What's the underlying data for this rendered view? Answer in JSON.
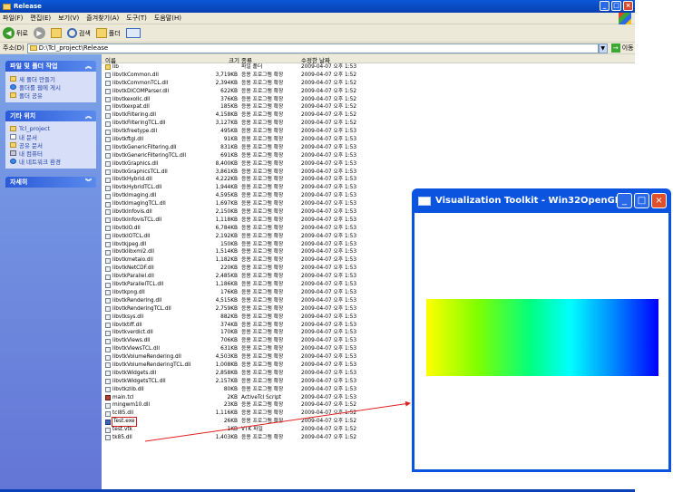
{
  "explorer": {
    "title": "Release",
    "menu": [
      "파일(F)",
      "편집(E)",
      "보기(V)",
      "즐겨찾기(A)",
      "도구(T)",
      "도움말(H)"
    ],
    "toolbar": {
      "back": "뒤로",
      "search": "검색",
      "folders": "폴더"
    },
    "address": {
      "label": "주소(D)",
      "path": "D:\\Tcl_project\\Release",
      "go": "이동"
    },
    "tasks": {
      "title": "파일 및 폴더 작업",
      "items": [
        "새 폴더 만들기",
        "폴더를 웹에 게시",
        "폴더 공유"
      ]
    },
    "places": {
      "title": "기타 위치",
      "items": [
        "Tcl_project",
        "내 문서",
        "공유 문서",
        "내 컴퓨터",
        "내 네트워크 환경"
      ]
    },
    "details": {
      "title": "자세히"
    },
    "columns": {
      "name": "이름",
      "size": "크기",
      "type": "종류",
      "date": "수정한 날짜"
    },
    "files": [
      {
        "name": "lib",
        "size": "",
        "type": "파일 폴더",
        "date": "2009-04-07 오후 1:53",
        "icon": "folder"
      },
      {
        "name": "libvtkCommon.dll",
        "size": "3,719KB",
        "type": "응용 프로그램 확장",
        "date": "2009-04-07 오후 1:52",
        "icon": "dll"
      },
      {
        "name": "libvtkCommonTCL.dll",
        "size": "2,394KB",
        "type": "응용 프로그램 확장",
        "date": "2009-04-07 오후 1:52",
        "icon": "dll"
      },
      {
        "name": "libvtkDICOMParser.dll",
        "size": "622KB",
        "type": "응용 프로그램 확장",
        "date": "2009-04-07 오후 1:52",
        "icon": "dll"
      },
      {
        "name": "libvtkexoIIc.dll",
        "size": "376KB",
        "type": "응용 프로그램 확장",
        "date": "2009-04-07 오후 1:52",
        "icon": "dll"
      },
      {
        "name": "libvtkexpat.dll",
        "size": "185KB",
        "type": "응용 프로그램 확장",
        "date": "2009-04-07 오후 1:52",
        "icon": "dll"
      },
      {
        "name": "libvtkFiltering.dll",
        "size": "4,158KB",
        "type": "응용 프로그램 확장",
        "date": "2009-04-07 오후 1:52",
        "icon": "dll"
      },
      {
        "name": "libvtkFilteringTCL.dll",
        "size": "3,127KB",
        "type": "응용 프로그램 확장",
        "date": "2009-04-07 오후 1:52",
        "icon": "dll"
      },
      {
        "name": "libvtkfreetype.dll",
        "size": "495KB",
        "type": "응용 프로그램 확장",
        "date": "2009-04-07 오후 1:53",
        "icon": "dll"
      },
      {
        "name": "libvtkftgl.dll",
        "size": "91KB",
        "type": "응용 프로그램 확장",
        "date": "2009-04-07 오후 1:53",
        "icon": "dll"
      },
      {
        "name": "libvtkGenericFiltering.dll",
        "size": "831KB",
        "type": "응용 프로그램 확장",
        "date": "2009-04-07 오후 1:53",
        "icon": "dll"
      },
      {
        "name": "libvtkGenericFilteringTCL.dll",
        "size": "691KB",
        "type": "응용 프로그램 확장",
        "date": "2009-04-07 오후 1:53",
        "icon": "dll"
      },
      {
        "name": "libvtkGraphics.dll",
        "size": "8,400KB",
        "type": "응용 프로그램 확장",
        "date": "2009-04-07 오후 1:53",
        "icon": "dll"
      },
      {
        "name": "libvtkGraphicsTCL.dll",
        "size": "3,861KB",
        "type": "응용 프로그램 확장",
        "date": "2009-04-07 오후 1:53",
        "icon": "dll"
      },
      {
        "name": "libvtkHybrid.dll",
        "size": "4,222KB",
        "type": "응용 프로그램 확장",
        "date": "2009-04-07 오후 1:53",
        "icon": "dll"
      },
      {
        "name": "libvtkHybridTCL.dll",
        "size": "1,944KB",
        "type": "응용 프로그램 확장",
        "date": "2009-04-07 오후 1:53",
        "icon": "dll"
      },
      {
        "name": "libvtkImaging.dll",
        "size": "4,595KB",
        "type": "응용 프로그램 확장",
        "date": "2009-04-07 오후 1:53",
        "icon": "dll"
      },
      {
        "name": "libvtkImagingTCL.dll",
        "size": "1,697KB",
        "type": "응용 프로그램 확장",
        "date": "2009-04-07 오후 1:53",
        "icon": "dll"
      },
      {
        "name": "libvtkInfovis.dll",
        "size": "2,150KB",
        "type": "응용 프로그램 확장",
        "date": "2009-04-07 오후 1:53",
        "icon": "dll"
      },
      {
        "name": "libvtkInfovisTCL.dll",
        "size": "1,118KB",
        "type": "응용 프로그램 확장",
        "date": "2009-04-07 오후 1:53",
        "icon": "dll"
      },
      {
        "name": "libvtkIO.dll",
        "size": "6,784KB",
        "type": "응용 프로그램 확장",
        "date": "2009-04-07 오후 1:53",
        "icon": "dll"
      },
      {
        "name": "libvtkIOTCL.dll",
        "size": "2,192KB",
        "type": "응용 프로그램 확장",
        "date": "2009-04-07 오후 1:53",
        "icon": "dll"
      },
      {
        "name": "libvtkjpeg.dll",
        "size": "150KB",
        "type": "응용 프로그램 확장",
        "date": "2009-04-07 오후 1:53",
        "icon": "dll"
      },
      {
        "name": "libvtklibxml2.dll",
        "size": "1,514KB",
        "type": "응용 프로그램 확장",
        "date": "2009-04-07 오후 1:53",
        "icon": "dll"
      },
      {
        "name": "libvtkmetaio.dll",
        "size": "1,182KB",
        "type": "응용 프로그램 확장",
        "date": "2009-04-07 오후 1:53",
        "icon": "dll"
      },
      {
        "name": "libvtkNetCDF.dll",
        "size": "220KB",
        "type": "응용 프로그램 확장",
        "date": "2009-04-07 오후 1:53",
        "icon": "dll"
      },
      {
        "name": "libvtkParallel.dll",
        "size": "2,485KB",
        "type": "응용 프로그램 확장",
        "date": "2009-04-07 오후 1:53",
        "icon": "dll"
      },
      {
        "name": "libvtkParallelTCL.dll",
        "size": "1,186KB",
        "type": "응용 프로그램 확장",
        "date": "2009-04-07 오후 1:53",
        "icon": "dll"
      },
      {
        "name": "libvtkpng.dll",
        "size": "176KB",
        "type": "응용 프로그램 확장",
        "date": "2009-04-07 오후 1:53",
        "icon": "dll"
      },
      {
        "name": "libvtkRendering.dll",
        "size": "4,515KB",
        "type": "응용 프로그램 확장",
        "date": "2009-04-07 오후 1:53",
        "icon": "dll"
      },
      {
        "name": "libvtkRenderingTCL.dll",
        "size": "2,759KB",
        "type": "응용 프로그램 확장",
        "date": "2009-04-07 오후 1:53",
        "icon": "dll"
      },
      {
        "name": "libvtksys.dll",
        "size": "882KB",
        "type": "응용 프로그램 확장",
        "date": "2009-04-07 오후 1:53",
        "icon": "dll"
      },
      {
        "name": "libvtktiff.dll",
        "size": "374KB",
        "type": "응용 프로그램 확장",
        "date": "2009-04-07 오후 1:53",
        "icon": "dll"
      },
      {
        "name": "libvtkverdict.dll",
        "size": "170KB",
        "type": "응용 프로그램 확장",
        "date": "2009-04-07 오후 1:53",
        "icon": "dll"
      },
      {
        "name": "libvtkViews.dll",
        "size": "706KB",
        "type": "응용 프로그램 확장",
        "date": "2009-04-07 오후 1:53",
        "icon": "dll"
      },
      {
        "name": "libvtkViewsTCL.dll",
        "size": "631KB",
        "type": "응용 프로그램 확장",
        "date": "2009-04-07 오후 1:53",
        "icon": "dll"
      },
      {
        "name": "libvtkVolumeRendering.dll",
        "size": "4,503KB",
        "type": "응용 프로그램 확장",
        "date": "2009-04-07 오후 1:53",
        "icon": "dll"
      },
      {
        "name": "libvtkVolumeRenderingTCL.dll",
        "size": "1,008KB",
        "type": "응용 프로그램 확장",
        "date": "2009-04-07 오후 1:53",
        "icon": "dll"
      },
      {
        "name": "libvtkWidgets.dll",
        "size": "2,858KB",
        "type": "응용 프로그램 확장",
        "date": "2009-04-07 오후 1:53",
        "icon": "dll"
      },
      {
        "name": "libvtkWidgetsTCL.dll",
        "size": "2,157KB",
        "type": "응용 프로그램 확장",
        "date": "2009-04-07 오후 1:53",
        "icon": "dll"
      },
      {
        "name": "libvtkzlib.dll",
        "size": "80KB",
        "type": "응용 프로그램 확장",
        "date": "2009-04-07 오후 1:53",
        "icon": "dll"
      },
      {
        "name": "main.tcl",
        "size": "2KB",
        "type": "ActiveTcl Script",
        "date": "2009-04-07 오후 1:53",
        "icon": "tcl"
      },
      {
        "name": "mingwm10.dll",
        "size": "23KB",
        "type": "응용 프로그램 확장",
        "date": "2009-04-07 오후 1:52",
        "icon": "dll"
      },
      {
        "name": "tcl85.dll",
        "size": "1,116KB",
        "type": "응용 프로그램 확장",
        "date": "2009-04-07 오후 1:52",
        "icon": "dll"
      },
      {
        "name": "Test.exe",
        "size": "26KB",
        "type": "응용 프로그램 확장",
        "date": "2009-04-07 오후 1:52",
        "icon": "exe",
        "selected": true
      },
      {
        "name": "test.vtk",
        "size": "1KB",
        "type": "VTK 파일",
        "date": "2009-04-07 오후 1:52",
        "icon": "doc"
      },
      {
        "name": "tk85.dll",
        "size": "1,403KB",
        "type": "응용 프로그램 확장",
        "date": "2009-04-07 오후 1:52",
        "icon": "dll"
      }
    ]
  },
  "vtk": {
    "title": "Visualization Toolkit - Win32OpenGL...",
    "colors": [
      "#ffff00",
      "#80ff00",
      "#00ff80",
      "#00ffff",
      "#0080ff",
      "#0000ff"
    ]
  }
}
